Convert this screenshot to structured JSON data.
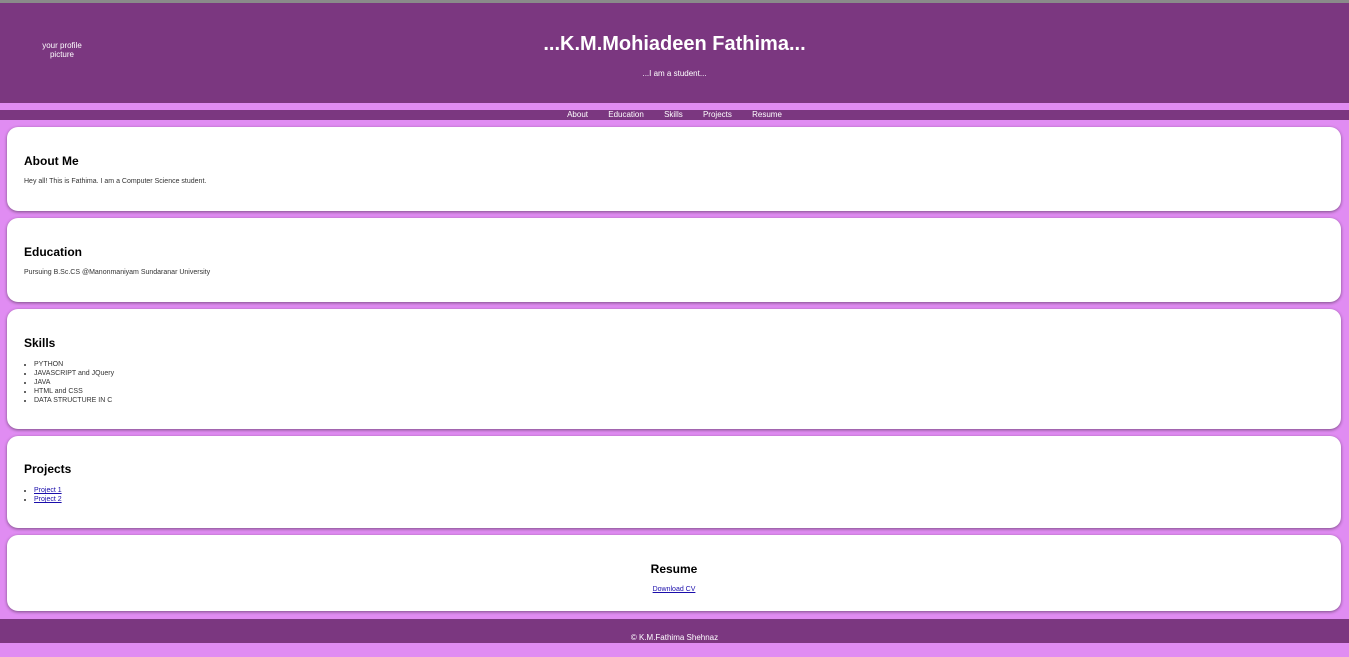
{
  "header": {
    "avatar_alt": "your profile picture",
    "title": "...K.M.Mohiadeen Fathima...",
    "tagline": "...I am a student..."
  },
  "nav": {
    "items": [
      {
        "label": "About"
      },
      {
        "label": "Education"
      },
      {
        "label": "Skills"
      },
      {
        "label": "Projects"
      },
      {
        "label": "Resume"
      }
    ]
  },
  "about": {
    "heading": "About Me",
    "text": "Hey all! This is Fathima. I am a Computer Science student."
  },
  "education": {
    "heading": "Education",
    "text": "Pursuing B.Sc.CS @Manonmaniyam Sundaranar University"
  },
  "skills": {
    "heading": "Skills",
    "items": [
      "PYTHON",
      "JAVASCRIPT and JQuery",
      "JAVA",
      "HTML and CSS",
      "DATA STRUCTURE IN C"
    ]
  },
  "projects": {
    "heading": "Projects",
    "items": [
      "Project 1",
      "Project 2"
    ]
  },
  "resume": {
    "heading": "Resume",
    "link": "Download CV"
  },
  "footer": {
    "text": "© K.M.Fathima Shehnaz"
  },
  "colors": {
    "header_bg": "#7b3780",
    "page_bg": "#e08cf2",
    "card_bg": "#ffffff"
  }
}
